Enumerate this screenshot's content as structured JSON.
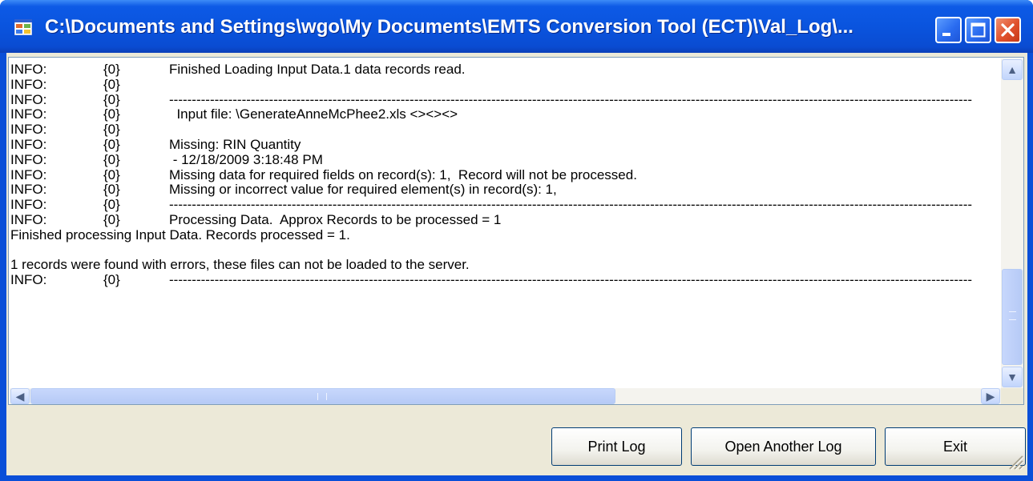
{
  "window": {
    "title": "C:\\Documents and Settings\\wgo\\My Documents\\EMTS Conversion Tool (ECT)\\Val_Log\\...",
    "controls": [
      "minimize",
      "maximize",
      "close"
    ]
  },
  "log_lines": [
    {
      "level": "INFO:",
      "code": "{0}",
      "message": "Finished Loading Input Data.1 data records read."
    },
    {
      "level": "INFO:",
      "code": "{0}",
      "message": ""
    },
    {
      "level": "INFO:",
      "code": "{0}",
      "message": "---------------------------------------------------------------------------------------------------------------------------------------------------------------------------------"
    },
    {
      "level": "INFO:",
      "code": "{0}",
      "message": "  Input file: \\GenerateAnneMcPhee2.xls <><><>"
    },
    {
      "level": "INFO:",
      "code": "{0}",
      "message": ""
    },
    {
      "level": "INFO:",
      "code": "{0}",
      "message": "Missing: RIN Quantity"
    },
    {
      "level": "INFO:",
      "code": "{0}",
      "message": " - 12/18/2009 3:18:48 PM"
    },
    {
      "level": "INFO:",
      "code": "{0}",
      "message": "Missing data for required fields on record(s): 1,  Record will not be processed."
    },
    {
      "level": "INFO:",
      "code": "{0}",
      "message": "Missing or incorrect value for required element(s) in record(s): 1,"
    },
    {
      "level": "INFO:",
      "code": "{0}",
      "message": "---------------------------------------------------------------------------------------------------------------------------------------------------------------------------------"
    },
    {
      "level": "INFO:",
      "code": "{0}",
      "message": "Processing Data.  Approx Records to be processed = 1"
    },
    {
      "text": "Finished processing Input Data. Records processed = 1."
    },
    {
      "text": ""
    },
    {
      "text": "1 records were found with errors, these files can not be loaded to the server."
    },
    {
      "level": "INFO:",
      "code": "{0}",
      "message": "---------------------------------------------------------------------------------------------------------------------------------------------------------------------------------"
    }
  ],
  "scrollbars": {
    "vertical_arrows": {
      "up": "▲",
      "down": "▼"
    },
    "horizontal_arrows": {
      "left": "◀",
      "right": "▶"
    }
  },
  "buttons": {
    "print": "Print Log",
    "open": "Open Another Log",
    "exit": "Exit"
  },
  "colors": {
    "titlebar": "#0a54de",
    "client_bg": "#ece9d8",
    "close_button": "#e0502c",
    "button_border": "#003c74"
  }
}
